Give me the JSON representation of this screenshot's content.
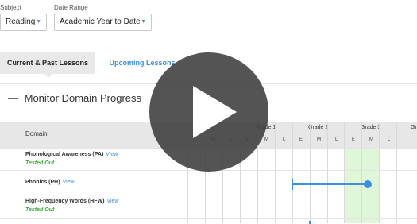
{
  "filters": {
    "subject_label": "Subject",
    "subject_value": "Reading",
    "date_label": "Date Range",
    "date_value": "Academic Year to Date"
  },
  "tabs": [
    {
      "label": "Current & Past Lessons",
      "active": true
    },
    {
      "label": "Upcoming Lessons",
      "active": false
    }
  ],
  "panel": {
    "title": "Monitor Domain Progress",
    "collapse_symbol": "—"
  },
  "grid": {
    "domain_header": "Domain",
    "grades": [
      "Grade 1",
      "Grade 2",
      "Grade 3",
      "Gr"
    ],
    "sub_cols": [
      "M",
      "L",
      "E",
      "M",
      "L",
      "E",
      "M",
      "L",
      "E",
      "M",
      "L"
    ],
    "rows": [
      {
        "name": "Phonological Awareness (PA)",
        "view": "View",
        "status": "Tested Out"
      },
      {
        "name": "Phonics (PH)",
        "view": "View",
        "status": ""
      },
      {
        "name": "High-Frequency Words (HFW)",
        "view": "View",
        "status": "Tested Out"
      }
    ]
  },
  "colors": {
    "accent": "#3d8fe0",
    "tested_out": "#3aa93a",
    "highlight": "#dff6d8",
    "overlay": "#3c3c3c"
  },
  "overlay": {
    "icon": "play-icon"
  }
}
